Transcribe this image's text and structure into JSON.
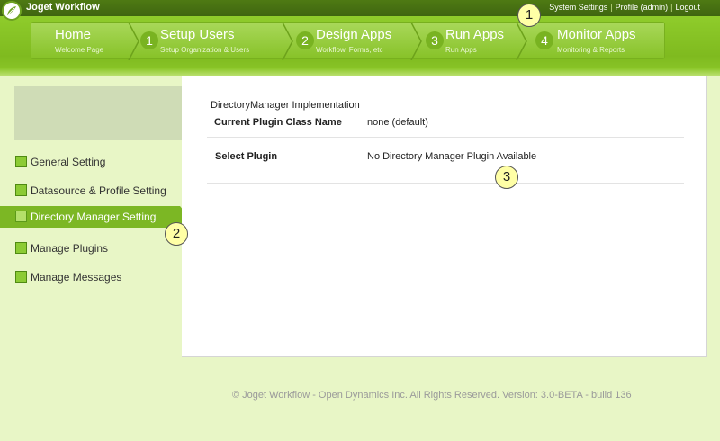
{
  "app": {
    "brand": "Joget Workflow"
  },
  "top_links": {
    "system_settings": "System Settings",
    "profile": "Profile (admin)",
    "logout": "Logout",
    "separator": "|"
  },
  "nav": [
    {
      "num": "",
      "title": "Home",
      "sub": "Welcome Page"
    },
    {
      "num": "1",
      "title": "Setup Users",
      "sub": "Setup Organization & Users"
    },
    {
      "num": "2",
      "title": "Design Apps",
      "sub": "Workflow, Forms, etc"
    },
    {
      "num": "3",
      "title": "Run Apps",
      "sub": "Run Apps"
    },
    {
      "num": "4",
      "title": "Monitor Apps",
      "sub": "Monitoring & Reports"
    }
  ],
  "sidebar": {
    "items": [
      {
        "label": "General Setting"
      },
      {
        "label": "Datasource & Profile Setting"
      },
      {
        "label": "Directory Manager Setting",
        "active": true
      },
      {
        "label": "Manage Plugins"
      },
      {
        "label": "Manage Messages"
      }
    ]
  },
  "content": {
    "section_title": "DirectoryManager Implementation",
    "current_plugin_label": "Current Plugin Class Name",
    "current_plugin_value": "none (default)",
    "select_plugin_label": "Select Plugin",
    "select_plugin_value": "No Directory Manager Plugin Available"
  },
  "callouts": [
    "1",
    "2",
    "3"
  ],
  "footer": "© Joget Workflow - Open Dynamics Inc. All Rights Reserved. Version: 3.0-BETA - build 136",
  "colors": {
    "brand_green": "#7cb724",
    "dark_green": "#3f6510",
    "background": "#e8f6c6",
    "callout": "#ffffa6"
  }
}
